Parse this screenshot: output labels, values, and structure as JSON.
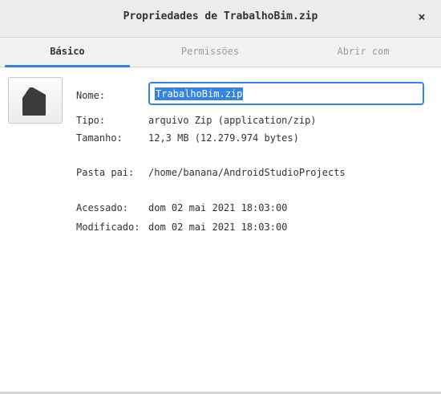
{
  "window": {
    "title": "Propriedades de TrabalhoBim.zip",
    "close_glyph": "×"
  },
  "tabs": [
    {
      "label": "Básico",
      "active": true
    },
    {
      "label": "Permissões",
      "active": false
    },
    {
      "label": "Abrir com",
      "active": false
    }
  ],
  "file_icon": "archive-file-icon",
  "fields": {
    "name_label": "Nome:",
    "name_value": "TrabalhoBim.zip",
    "type_label": "Tipo:",
    "type_value": "arquivo Zip (application/zip)",
    "size_label": "Tamanho:",
    "size_value": "12,3 MB (12.279.974 bytes)",
    "parent_label": "Pasta pai:",
    "parent_value": "/home/banana/AndroidStudioProjects",
    "accessed_label": "Acessado:",
    "accessed_value": "dom 02 mai 2021 18:03:00",
    "modified_label": "Modificado:",
    "modified_value": "dom 02 mai 2021 18:03:00"
  },
  "colors": {
    "accent": "#3584e4",
    "titlebar": "#ececeb",
    "tabbar": "#f2f2f1",
    "text": "#2e3436",
    "inactive_tab_text": "#9a9e9a"
  }
}
